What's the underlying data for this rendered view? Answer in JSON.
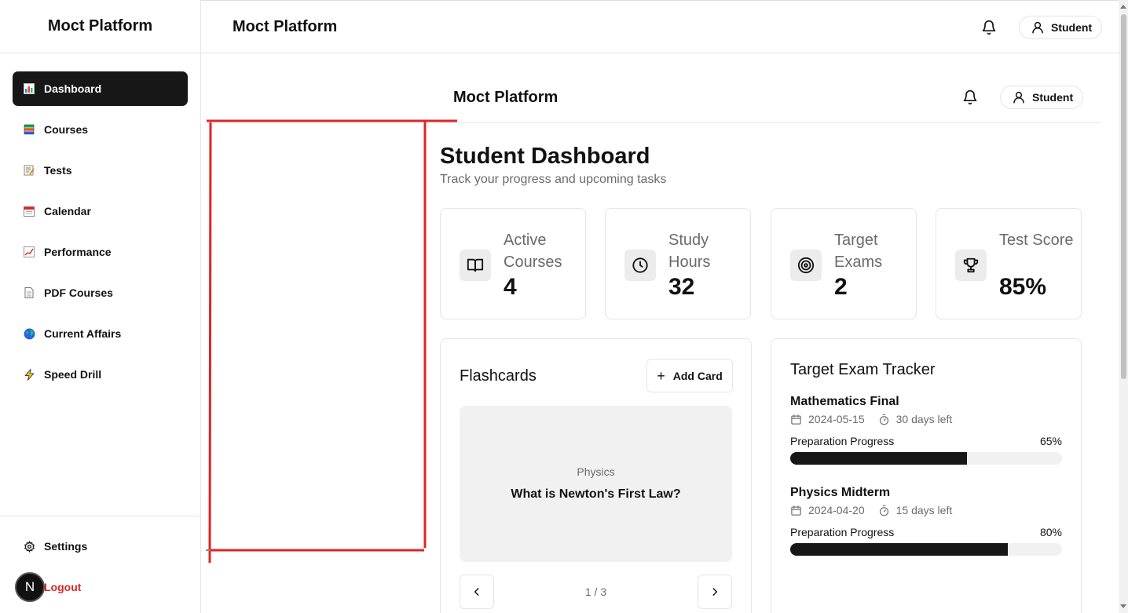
{
  "sidebar": {
    "brand": "Moct Platform",
    "items": [
      {
        "label": "Dashboard",
        "icon": "bar-chart-icon",
        "active": true
      },
      {
        "label": "Courses",
        "icon": "books-icon"
      },
      {
        "label": "Tests",
        "icon": "memo-icon"
      },
      {
        "label": "Calendar",
        "icon": "calendar-icon"
      },
      {
        "label": "Performance",
        "icon": "chart-increasing-icon"
      },
      {
        "label": "PDF Courses",
        "icon": "page-icon"
      },
      {
        "label": "Current Affairs",
        "icon": "globe-icon"
      },
      {
        "label": "Speed Drill",
        "icon": "lightning-icon"
      }
    ],
    "settings_label": "Settings",
    "logout_label": "Logout",
    "badge_letter": "N"
  },
  "topbar": {
    "title": "Moct Platform",
    "user_label": "Student"
  },
  "inner_header": {
    "title": "Moct Platform",
    "user_label": "Student"
  },
  "dashboard": {
    "title": "Student Dashboard",
    "subtitle": "Track your progress and upcoming tasks",
    "stats": [
      {
        "label": "Active Courses",
        "value": "4",
        "icon": "book-open-icon"
      },
      {
        "label": "Study Hours",
        "value": "32",
        "icon": "clock-icon"
      },
      {
        "label": "Target Exams",
        "value": "2",
        "icon": "target-icon"
      },
      {
        "label": "Test Score",
        "value": "85%",
        "icon": "trophy-icon"
      }
    ]
  },
  "flashcards": {
    "title": "Flashcards",
    "add_label": "Add Card",
    "subject": "Physics",
    "question": "What is Newton's First Law?",
    "pager": "1 / 3"
  },
  "tracker": {
    "title": "Target Exam Tracker",
    "exams": [
      {
        "name": "Mathematics Final",
        "date": "2024-05-15",
        "days_left": "30 days left",
        "progress_label": "Preparation Progress",
        "progress_text": "65%",
        "progress": 0.65
      },
      {
        "name": "Physics Midterm",
        "date": "2024-04-20",
        "days_left": "15 days left",
        "progress_label": "Preparation Progress",
        "progress_text": "80%",
        "progress": 0.8
      }
    ]
  },
  "colors": {
    "accent": "#171717",
    "logout": "#dc2626",
    "annotation": "#e02424"
  }
}
